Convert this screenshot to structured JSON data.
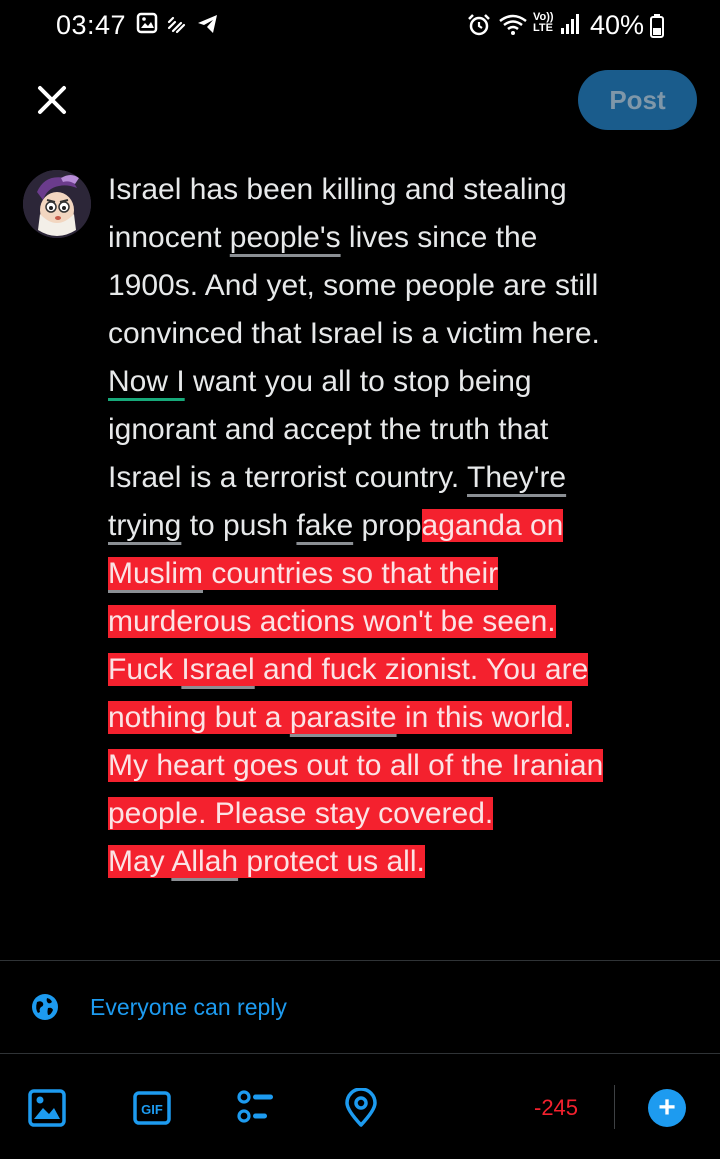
{
  "status_bar": {
    "time": "03:47",
    "network_label": "Vo)) LTE",
    "battery": "40%"
  },
  "top_bar": {
    "post_label": "Post"
  },
  "compose": {
    "lines": [
      [
        {
          "t": "Israel has been killing and stealing"
        }
      ],
      [
        {
          "t": "innocent "
        },
        {
          "t": "people's",
          "u": 1
        },
        {
          "t": " lives since the"
        }
      ],
      [
        {
          "t": "1900s. And yet, some people are still"
        }
      ],
      [
        {
          "t": "convinced that Israel is a victim here."
        }
      ],
      [
        {
          "t": "Now I",
          "g": 1
        },
        {
          "t": " want you all to stop being"
        }
      ],
      [
        {
          "t": "ignorant and accept the truth that"
        }
      ],
      [
        {
          "t": "Israel is a terrorist country. "
        },
        {
          "t": "They're",
          "u": 1
        }
      ],
      [
        {
          "t": "trying",
          "u": 1
        },
        {
          "t": " to push "
        },
        {
          "t": "fake",
          "u": 1
        },
        {
          "t": " prop"
        },
        {
          "t": "aganda on",
          "o": 1
        }
      ],
      [
        {
          "t": "Muslim",
          "u": 1,
          "o": 1
        },
        {
          "t": " countries so that their",
          "o": 1
        }
      ],
      [
        {
          "t": "murderous actions won't be seen.",
          "o": 1
        }
      ],
      [
        {
          "t": "Fuck ",
          "o": 1
        },
        {
          "t": "Israel",
          "u": 1,
          "o": 1
        },
        {
          "t": " and fuck zionist. You are",
          "o": 1
        }
      ],
      [
        {
          "t": "nothing but a ",
          "o": 1
        },
        {
          "t": "parasite",
          "u": 1,
          "o": 1
        },
        {
          "t": " in this world.",
          "o": 1
        }
      ],
      [
        {
          "t": "My heart goes out to all of the Iranian",
          "o": 1
        }
      ],
      [
        {
          "t": "people. Please stay covered.",
          "o": 1
        }
      ],
      [
        {
          "t": "May ",
          "o": 1
        },
        {
          "t": "Allah",
          "u": 1,
          "o": 1
        },
        {
          "t": " protect us all.",
          "o": 1
        }
      ]
    ],
    "overflow_color": "#f4212e"
  },
  "reply_setting": {
    "icon": "globe-icon",
    "label": "Everyone can reply"
  },
  "toolbar": {
    "items": [
      "image-icon",
      "gif-icon",
      "poll-icon",
      "location-icon"
    ],
    "gif_label": "GIF",
    "char_count": "-245",
    "add_label": "+"
  },
  "colors": {
    "accent": "#1d9bf0",
    "post_disabled": "#1a5c8c",
    "error": "#f4212e"
  }
}
